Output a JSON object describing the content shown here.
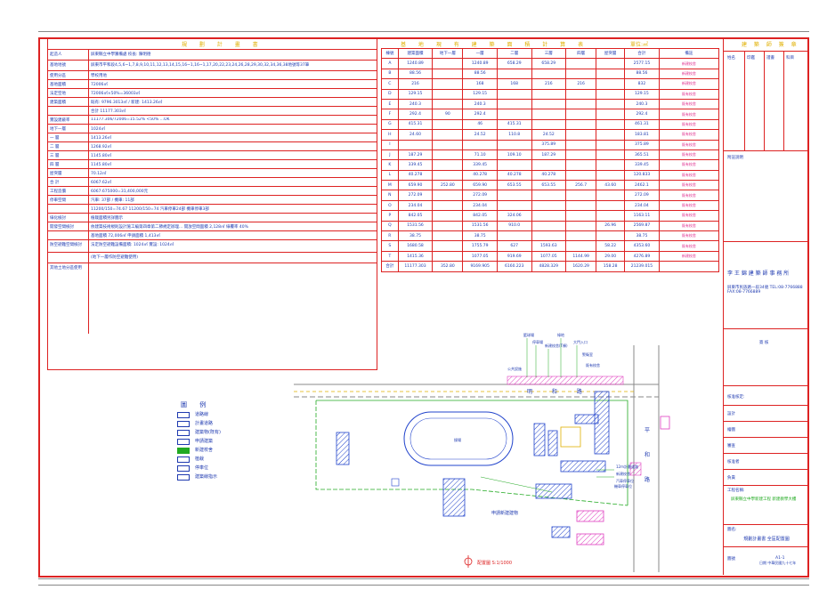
{
  "left_table": {
    "title": "規 劃 計 畫 書",
    "rows": [
      {
        "k": "起造人",
        "v": "屏東縣立中學籌備處 校長: 陳明德"
      },
      {
        "k": "基地地號",
        "v": "屏東市平和段4,5,6~1,7,8,9,10,11,12,13,14,15,16~1,16~1,17,20,22,23,24,26,28,29,30,32,34,36,38地號等37筆"
      },
      {
        "k": "使用分區",
        "v": "學校用地"
      },
      {
        "k": "基地面積",
        "v": "72006㎡"
      },
      {
        "k": "法定空地",
        "v": "72006㎡×50%=36003㎡"
      },
      {
        "k": "建築面積",
        "v": "既有: 9796.3013㎡ / 新建: 1413.26㎡"
      },
      {
        "k": "",
        "v": "合計 11177.303㎡"
      },
      {
        "k": "實設建蔽率",
        "v": "11177.306/72006=15.52% <50% ...OK"
      },
      {
        "k": "地下一層",
        "v": "1024㎡"
      },
      {
        "k": "一 層",
        "v": "1413.26㎡"
      },
      {
        "k": "二 層",
        "v": "1268.92㎡"
      },
      {
        "k": "三 層",
        "v": "1145.80㎡"
      },
      {
        "k": "四 層",
        "v": "1145.80㎡"
      },
      {
        "k": "屋突層",
        "v": "70.12㎡"
      },
      {
        "k": "合 計",
        "v": "6067.62㎡"
      },
      {
        "k": "工程造價",
        "v": "6067.675000=31,400,000元"
      },
      {
        "k": "停車空間",
        "v": "汽車: 37部 / 機車: 11部"
      },
      {
        "k": "",
        "v": "11200/150=74.67  11200/150=74  汽車停車24部 機車停車3部"
      },
      {
        "k": "綠化檢討",
        "v": "植栽面積另詳圖示"
      },
      {
        "k": "開發空間檢討",
        "v": "依建築技術規則設計施工編第四章第二節規定辦理... 開放空間面積 2,128㎡ 綠覆率 40%"
      },
      {
        "k": "",
        "v": "基地面積 72,006㎡ 申請面積 1,413㎡"
      },
      {
        "k": "防空避難空間檢討",
        "v": "法定防空避難設備面積: 1024㎡ 實設: 1024㎡"
      },
      {
        "k": "",
        "v": "(地下一層作防空避難使用)"
      },
      {
        "k": "其他土地分區使用",
        "v": ""
      }
    ]
  },
  "mid_table": {
    "title": "基 地 現 有 建 築 面 積 計 算 表",
    "unit": "單位:㎡",
    "headers": [
      "棟號",
      "建築面積",
      "地下一層",
      "一層",
      "二層",
      "三層",
      "四層",
      "屋突層",
      "合計",
      "備註"
    ],
    "rows": [
      [
        "A",
        "1240.89",
        "",
        "1240.89",
        "658.29",
        "658.29",
        "",
        "",
        "2577.15",
        "新建校舍"
      ],
      [
        "B",
        "88.56",
        "",
        "88.56",
        "",
        "",
        "",
        "",
        "88.56",
        "新建校舍"
      ],
      [
        "C",
        "216",
        "",
        "168",
        "168",
        "216",
        "216",
        "",
        "832",
        "新建校舍"
      ],
      [
        "D",
        "129.15",
        "",
        "129.15",
        "",
        "",
        "",
        "",
        "129.15",
        "既有校舍"
      ],
      [
        "E",
        "240.3",
        "",
        "240.3",
        "",
        "",
        "",
        "",
        "240.3",
        "既有校舍"
      ],
      [
        "F",
        "292.4",
        "90",
        "292.4",
        "",
        "",
        "",
        "",
        "292.4",
        "既有校舍"
      ],
      [
        "G",
        "415.31",
        "",
        "46",
        "415.31",
        "",
        "",
        "",
        "461.31",
        "既有校舍"
      ],
      [
        "H",
        "24.60",
        "",
        "24.52",
        "110.8",
        "24.52",
        "",
        "",
        "183.81",
        "既有校舍"
      ],
      [
        "I",
        "",
        "",
        "",
        "",
        "375.89",
        "",
        "",
        "375.89",
        "既有校舍"
      ],
      [
        "J",
        "187.29",
        "",
        "71.10",
        "109.10",
        "187.29",
        "",
        "",
        "365.51",
        "既有校舍"
      ],
      [
        "K",
        "339.45",
        "",
        "339.45",
        "",
        "",
        "",
        "",
        "339.45",
        "既有校舍"
      ],
      [
        "L",
        "40.278",
        "",
        "40.278",
        "40.278",
        "40.278",
        "",
        "",
        "120.833",
        "既有校舍"
      ],
      [
        "M",
        "659.90",
        "252.80",
        "659.90",
        "653.55",
        "653.55",
        "256.7",
        "43.60",
        "2462.1",
        "既有校舍"
      ],
      [
        "N",
        "272.09",
        "",
        "272.09",
        "",
        "",
        "",
        "",
        "272.09",
        "既有校舍"
      ],
      [
        "O",
        "234.04",
        "",
        "234.04",
        "",
        "",
        "",
        "",
        "234.04",
        "既有校舍"
      ],
      [
        "P",
        "842.05",
        "",
        "842.05",
        "324.06",
        "",
        "",
        "",
        "1163.11",
        "既有校舍"
      ],
      [
        "Q",
        "1531.56",
        "",
        "1531.56",
        "910.0",
        "",
        "",
        "26.96",
        "2569.87",
        "既有校舍"
      ],
      [
        "R",
        "38.75",
        "",
        "38.75",
        "",
        "",
        "",
        "",
        "38.75",
        "既有校舍"
      ],
      [
        "S",
        "1680.58",
        "",
        "1755.79",
        "627",
        "1593.63",
        "",
        "58.22",
        "4353.60",
        "既有校舍"
      ],
      [
        "T",
        "1415.36",
        "",
        "1077.05",
        "919.69",
        "1077.05",
        "1144.99",
        "29.00",
        "4276.89",
        "新建校舍"
      ],
      [
        "合計",
        "11177.303",
        "352.80",
        "9169.905",
        "6160.223",
        "4828.329",
        "1620.29",
        "158.28",
        "21239.015",
        ""
      ]
    ]
  },
  "title_block": {
    "header": "建 築 師 簽 章",
    "cols": [
      "姓名",
      "印鑑",
      "證書",
      "科目"
    ],
    "notes_title": "附註說明",
    "firm": "李 王 錦 建 築 師 事 務 所",
    "firm_info": "屏東市民族路一段34號 TEL:08-7766888 FAX:08-7766889",
    "sign_label": "簽 核",
    "review_label": "核准核定:",
    "fields": [
      "設計",
      "繪圖",
      "審查",
      "核准者",
      "負責"
    ],
    "project_label": "工程名稱:",
    "project_name": "屏東縣立中學新建工程 新建教學大樓",
    "drawing_label": "圖名:",
    "drawing_name": "規劃計畫書 全區配置圖",
    "date": "日期 中華民國九十七年",
    "sheet_label": "圖號",
    "sheet_no": "A1-1"
  },
  "legend": {
    "title": "圖 例",
    "items": [
      "道路線",
      "計畫道路",
      "建築物(既有)",
      "申請建築",
      "新建校舍",
      "植栽",
      "停車位",
      "建築線指示"
    ]
  },
  "map": {
    "road_top": "明 和 路",
    "road_right": "平 和 路",
    "applied_building": "申請新建建物",
    "scale": "配置圖 S:1/1000",
    "track_label": "操場",
    "callouts": [
      "籃球場",
      "停車場",
      "新建校舍(T棟)",
      "綠地",
      "大門入口",
      "警衛室",
      "既有校舍",
      "公共設施",
      "12m計畫道路",
      "新建校舍",
      "汽車停車位",
      "機車停車位"
    ]
  },
  "colors": {
    "frame": "#dd2222",
    "table_text": "#1f3ab0",
    "title": "#e0b000",
    "hatch": "#2244cc",
    "pink": "#e040c0",
    "green": "#22aa22"
  }
}
